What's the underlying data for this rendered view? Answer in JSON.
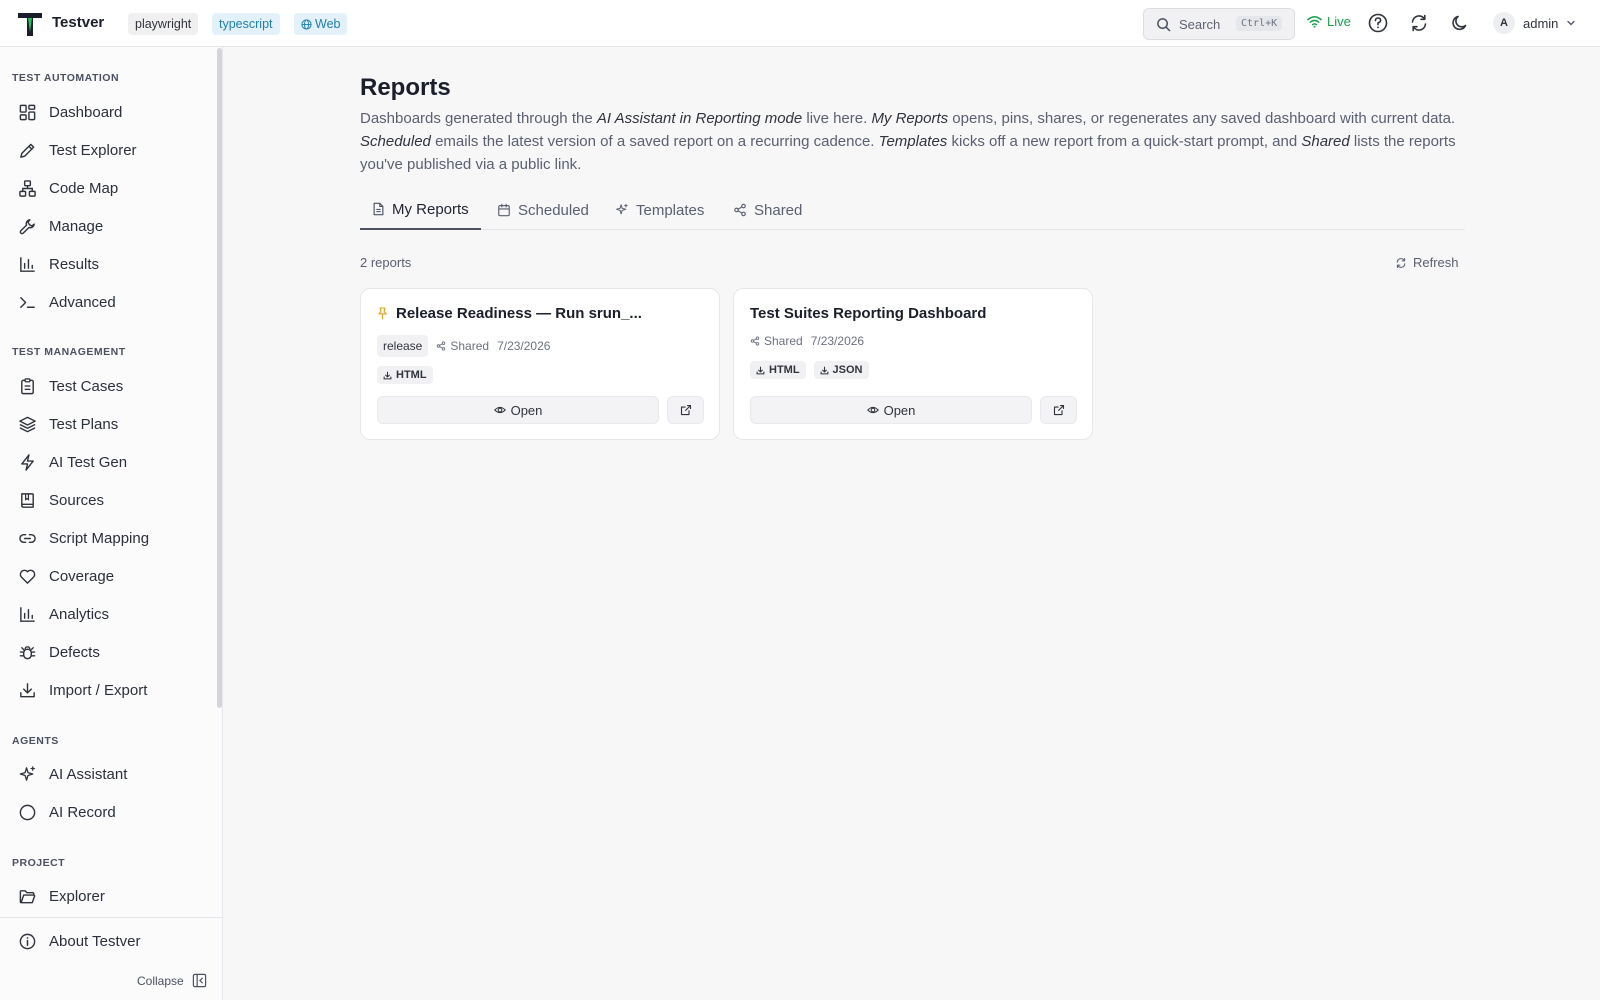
{
  "app": {
    "title": "Testver"
  },
  "header": {
    "tags": [
      "playwright",
      "typescript",
      "Web"
    ],
    "search": {
      "label": "Search",
      "shortcut": "Ctrl+K"
    },
    "live_label": "Live",
    "user": {
      "initial": "A",
      "name": "admin"
    },
    "colors": {
      "live": "#16a34a",
      "tag_blue": "#1f7fb8"
    }
  },
  "sidebar": {
    "sections": [
      {
        "title": "TEST AUTOMATION",
        "items": [
          {
            "label": "Dashboard",
            "icon": "dashboard-icon"
          },
          {
            "label": "Test Explorer",
            "icon": "pencil-icon"
          },
          {
            "label": "Code Map",
            "icon": "tree-icon"
          },
          {
            "label": "Manage",
            "icon": "wrench-icon"
          },
          {
            "label": "Results",
            "icon": "bar-chart-icon"
          },
          {
            "label": "Advanced",
            "icon": "terminal-icon"
          }
        ]
      },
      {
        "title": "TEST MANAGEMENT",
        "items": [
          {
            "label": "Test Cases",
            "icon": "clipboard-icon"
          },
          {
            "label": "Test Plans",
            "icon": "layers-icon"
          },
          {
            "label": "AI Test Gen",
            "icon": "bolt-icon"
          },
          {
            "label": "Sources",
            "icon": "book-icon"
          },
          {
            "label": "Script Mapping",
            "icon": "link-icon"
          },
          {
            "label": "Coverage",
            "icon": "heart-icon"
          },
          {
            "label": "Analytics",
            "icon": "bar-chart-icon"
          },
          {
            "label": "Defects",
            "icon": "bug-icon"
          },
          {
            "label": "Import / Export",
            "icon": "download-icon"
          }
        ]
      },
      {
        "title": "AGENTS",
        "items": [
          {
            "label": "AI Assistant",
            "icon": "sparkles-icon"
          },
          {
            "label": "AI Record",
            "icon": "circle-icon"
          }
        ]
      },
      {
        "title": "PROJECT",
        "items": [
          {
            "label": "Explorer",
            "icon": "folder-icon"
          }
        ]
      }
    ],
    "about": "About Testver",
    "collapse": "Collapse"
  },
  "page": {
    "title": "Reports",
    "description": {
      "p1": "Dashboards generated through the ",
      "e1": "AI Assistant in Reporting mode",
      "p2": " live here. ",
      "e2": "My Reports",
      "p3": " opens, pins, shares, or regenerates any saved dashboard with current data. ",
      "e3": "Scheduled",
      "p4": " emails the latest version of a saved report on a recurring cadence. ",
      "e4": "Templates",
      "p5": " kicks off a new report from a quick-start prompt, and ",
      "e5": "Shared",
      "p6": " lists the reports you've published via a public link."
    },
    "tabs": [
      {
        "label": "My Reports",
        "active": true
      },
      {
        "label": "Scheduled",
        "active": false
      },
      {
        "label": "Templates",
        "active": false
      },
      {
        "label": "Shared",
        "active": false
      }
    ],
    "count": "2 reports",
    "refresh": "Refresh",
    "reports": [
      {
        "title": "Release Readiness — Run srun_...",
        "pinned": true,
        "tag": "release",
        "shared": "Shared",
        "date": "7/23/2026",
        "formats": [
          "HTML"
        ],
        "open": "Open"
      },
      {
        "title": "Test Suites Reporting Dashboard",
        "pinned": false,
        "tag": "",
        "shared": "Shared",
        "date": "7/23/2026",
        "formats": [
          "HTML",
          "JSON"
        ],
        "open": "Open"
      }
    ]
  }
}
